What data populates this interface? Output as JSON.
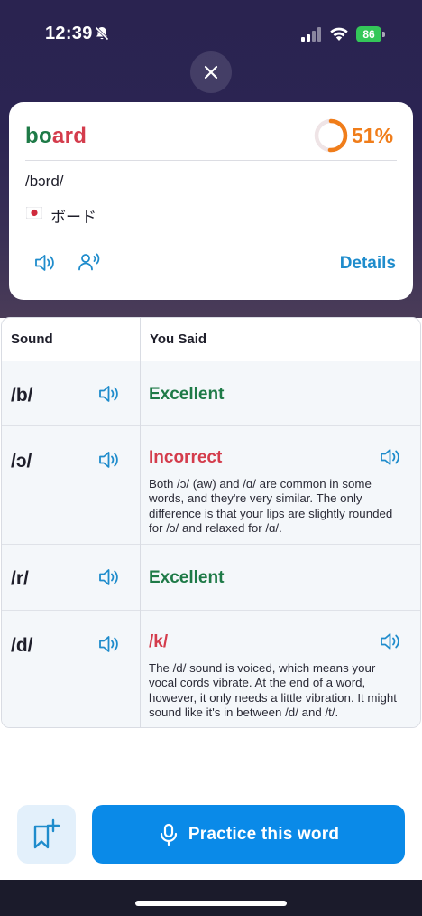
{
  "status_bar": {
    "time": "12:39",
    "battery": "86"
  },
  "word_card": {
    "word_good_part": "bo",
    "word_bad_part": "ard",
    "score": "51%",
    "score_fraction": 0.51,
    "ipa": "/bɔrd/",
    "translation": "ボード",
    "details_label": "Details"
  },
  "table": {
    "header_sound": "Sound",
    "header_you_said": "You Said",
    "rows": [
      {
        "phoneme": "/b/",
        "result": "Excellent",
        "status": "good",
        "explanation": ""
      },
      {
        "phoneme": "/ɔ/",
        "result": "Incorrect",
        "status": "bad",
        "explanation": "Both /ɔ/ (aw) and /ɑ/ are common in some words, and they're very similar. The only difference is that your lips are slightly rounded for /ɔ/ and relaxed for /ɑ/."
      },
      {
        "phoneme": "/r/",
        "result": "Excellent",
        "status": "good",
        "explanation": ""
      },
      {
        "phoneme": "/d/",
        "result": "/k/",
        "status": "bad",
        "explanation": "The /d/ sound is voiced, which means your vocal cords vibrate. At the end of a word, however, it only needs a little vibration. It might sound like it's in between /d/ and /t/."
      }
    ]
  },
  "actions": {
    "practice_label": "Practice this word"
  },
  "colors": {
    "good": "#1e7a47",
    "bad": "#d43c4c",
    "score": "#f07d1a",
    "accent": "#0a8ae8",
    "link": "#1f8ccc"
  }
}
